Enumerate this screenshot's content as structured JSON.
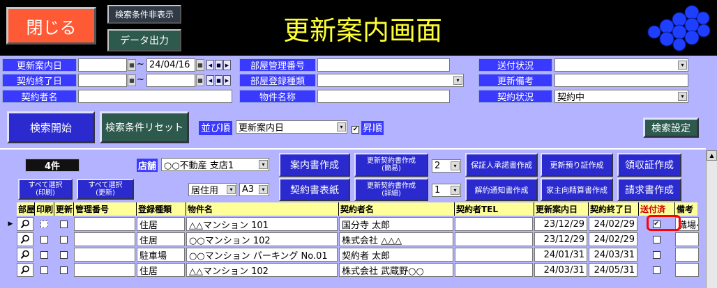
{
  "header": {
    "close_label": "閉じる",
    "hide_search_label": "検索条件非表示",
    "export_label": "データ出力",
    "title": "更新案内画面"
  },
  "search": {
    "renewal_notice_date_label": "更新案内日",
    "renewal_notice_date_from": "",
    "range_sep_1": "~",
    "renewal_notice_date_to": "24/04/16",
    "contract_end_label": "契約終了日",
    "contract_end_from": "",
    "range_sep_2": "~",
    "contract_end_to": "",
    "contractor_name_label": "契約者名",
    "contractor_name_value": "",
    "room_mgmt_no_label": "部屋管理番号",
    "room_mgmt_no_value": "",
    "room_reg_type_label": "部屋登録種類",
    "room_reg_type_value": "",
    "property_name_label": "物件名称",
    "property_name_value": "",
    "send_status_label": "送付状況",
    "send_status_value": "",
    "renewal_remarks_label": "更新備考",
    "renewal_remarks_value": "",
    "contract_status_label": "契約状況",
    "contract_status_value": "契約中",
    "search_start_label": "検索開始",
    "reset_label": "検索条件リセット",
    "sort_label": "並び順",
    "sort_value": "更新案内日",
    "asc_label": "昇順",
    "search_settings_label": "検索設定"
  },
  "panel": {
    "count_label": "4件",
    "store_label": "店舗",
    "store_value": "○○不動産 支店1",
    "select_all_print": "すべて選択\n(印刷)",
    "select_all_update": "すべて選択\n(更新)",
    "usage_value": "居住用",
    "paper_value": "A3",
    "guide_create": "案内書作成",
    "contract_cover": "契約書表紙",
    "renewal_contract_simple": "更新契約書作成\n(簡易)",
    "renewal_contract_detail": "更新契約書作成\n(詳細)",
    "copies_1": "2",
    "copies_2": "1",
    "guarantor_consent": "保証人承諾書作成",
    "cancel_notice": "解約通知書作成",
    "renewal_deposit": "更新預り証作成",
    "landlord_settlement": "家主向精算書作成",
    "receipt_create": "領収証作成",
    "invoice_create": "請求書作成"
  },
  "grid": {
    "columns": [
      "部屋",
      "印刷",
      "更新",
      "管理番号",
      "登録種類",
      "物件名",
      "契約者名",
      "契約者TEL",
      "更新案内日",
      "契約終了日",
      "送付済",
      "備考"
    ],
    "rows": [
      {
        "type": "住居",
        "property": "△△マンション 101",
        "contractor": "国分寺 太郎",
        "tel": "",
        "notice": "23/12/29",
        "end": "24/02/29",
        "remark": "職場へ"
      },
      {
        "type": "住居",
        "property": "○○マンション 102",
        "contractor": "株式会社 △△△",
        "tel": "",
        "notice": "23/12/29",
        "end": "24/02/29",
        "remark": ""
      },
      {
        "type": "駐車場",
        "property": "○○マンション パーキング No.01",
        "contractor": "契約者 太郎",
        "tel": "",
        "notice": "24/01/31",
        "end": "24/03/31",
        "remark": ""
      },
      {
        "type": "住居",
        "property": "△△マンション 102",
        "contractor": "株式会社 武蔵野○○",
        "tel": "",
        "notice": "24/03/31",
        "end": "24/05/31",
        "remark": ""
      }
    ]
  },
  "colors": {
    "header_bg": "#000000",
    "label_blue": "#3a3aff",
    "panel_bg": "#b3b3ff",
    "close_btn": "#ff5a36",
    "title_yellow": "#ffff33",
    "highlight_red": "#ff0000"
  }
}
